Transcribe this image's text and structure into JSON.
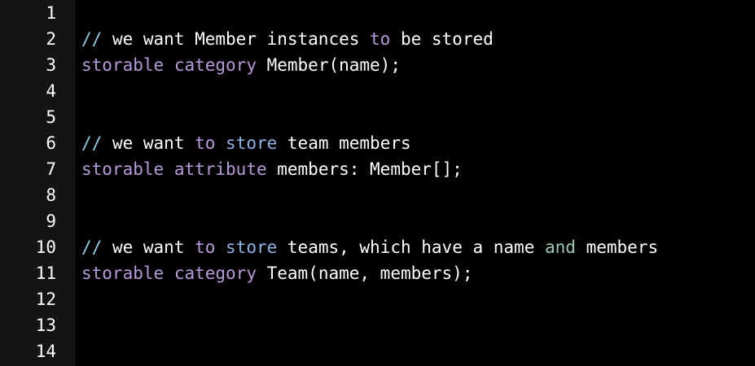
{
  "editor": {
    "line_numbers": [
      "1",
      "2",
      "3",
      "4",
      "5",
      "6",
      "7",
      "8",
      "9",
      "10",
      "11",
      "12",
      "13",
      "14"
    ],
    "lines": [
      [],
      [
        {
          "t": "// ",
          "c": "comment"
        },
        {
          "t": "we want Member instances ",
          "c": "plain"
        },
        {
          "t": "to",
          "c": "keyword"
        },
        {
          "t": " be stored",
          "c": "plain"
        }
      ],
      [
        {
          "t": "storable",
          "c": "keyword"
        },
        {
          "t": " ",
          "c": "plain"
        },
        {
          "t": "category",
          "c": "keyword"
        },
        {
          "t": " Member(name);",
          "c": "plain"
        }
      ],
      [],
      [],
      [
        {
          "t": "// ",
          "c": "comment"
        },
        {
          "t": "we want ",
          "c": "plain"
        },
        {
          "t": "to",
          "c": "keyword"
        },
        {
          "t": " ",
          "c": "plain"
        },
        {
          "t": "store",
          "c": "blue"
        },
        {
          "t": " team members",
          "c": "plain"
        }
      ],
      [
        {
          "t": "storable",
          "c": "keyword"
        },
        {
          "t": " ",
          "c": "plain"
        },
        {
          "t": "attribute",
          "c": "keyword"
        },
        {
          "t": " members: Member[];",
          "c": "plain"
        }
      ],
      [],
      [],
      [
        {
          "t": "// ",
          "c": "comment"
        },
        {
          "t": "we want ",
          "c": "plain"
        },
        {
          "t": "to",
          "c": "keyword"
        },
        {
          "t": " ",
          "c": "plain"
        },
        {
          "t": "store",
          "c": "blue"
        },
        {
          "t": " teams, which have a name ",
          "c": "plain"
        },
        {
          "t": "and",
          "c": "green"
        },
        {
          "t": " members",
          "c": "plain"
        }
      ],
      [
        {
          "t": "storable",
          "c": "keyword"
        },
        {
          "t": " ",
          "c": "plain"
        },
        {
          "t": "category",
          "c": "keyword"
        },
        {
          "t": " Team(name, members);",
          "c": "plain"
        }
      ],
      [],
      [],
      []
    ]
  },
  "colors": {
    "background": "#000000",
    "gutter": "#141414",
    "plain": "#ffffff",
    "comment": "#8fd1e6",
    "keyword": "#b79ad9",
    "blue": "#8fb3e6",
    "green": "#9cc9b0"
  }
}
